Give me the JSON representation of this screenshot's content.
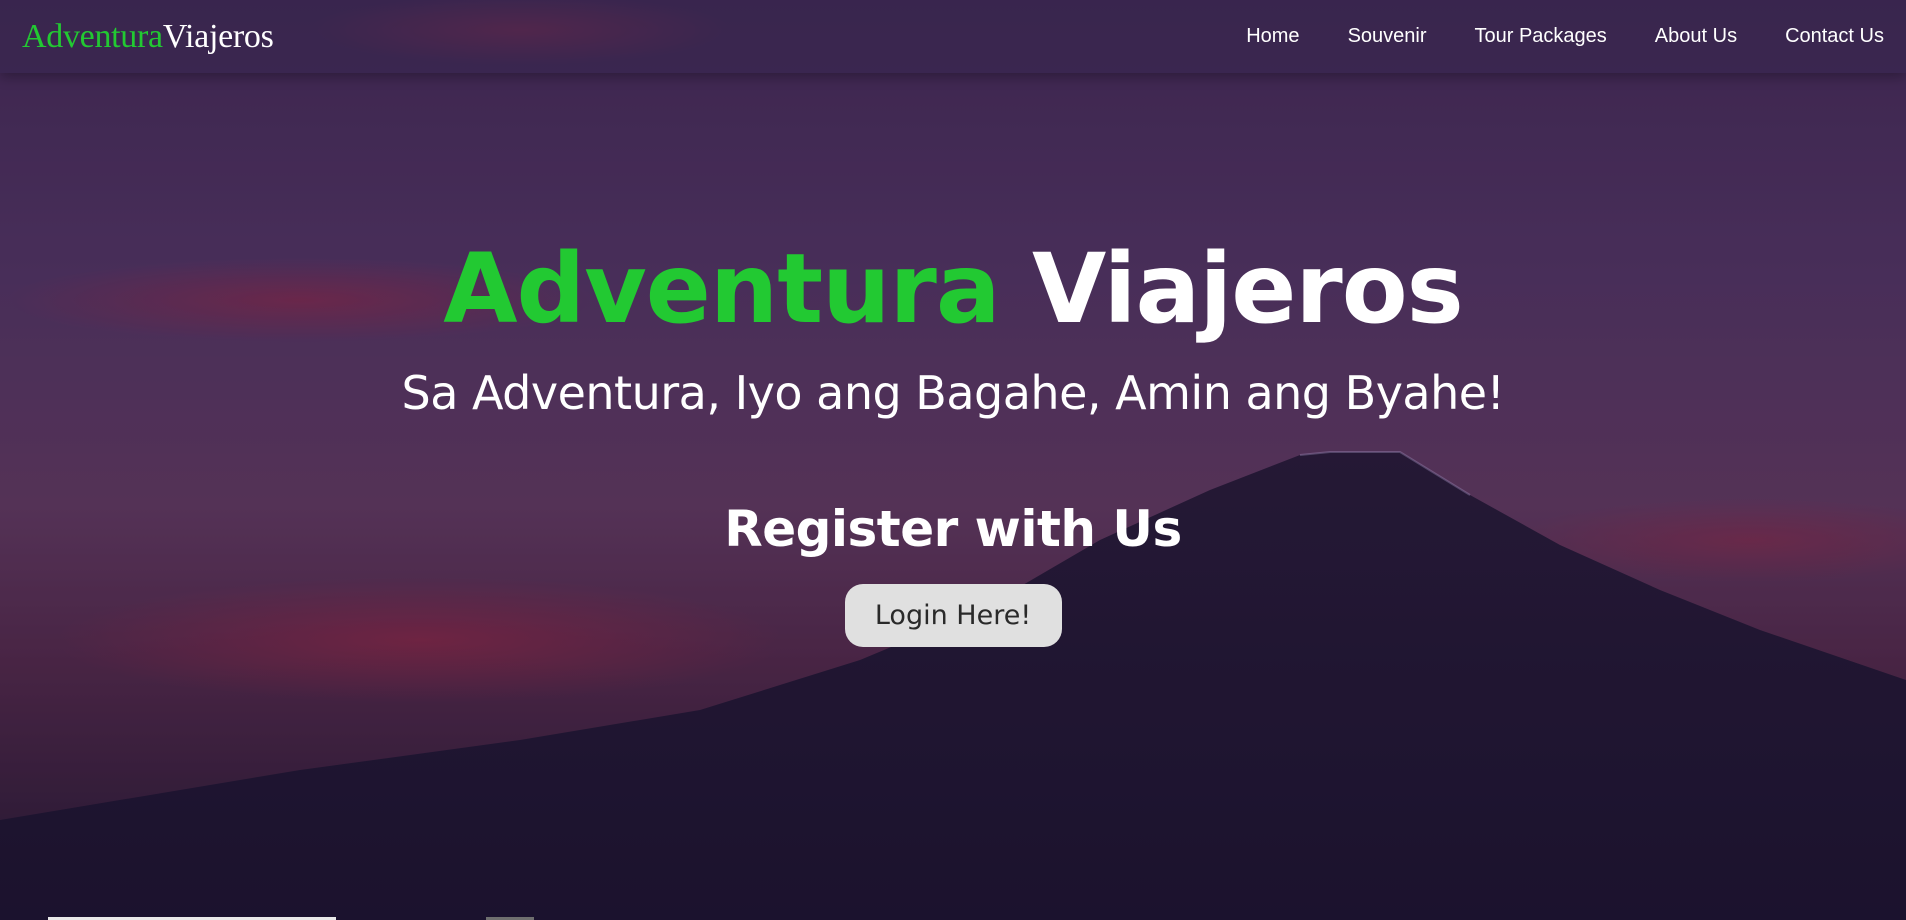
{
  "brand": {
    "part1": "Adventura",
    "part2": "Viajeros",
    "accent_color": "#22c932",
    "text_color": "#ffffff"
  },
  "nav": {
    "items": [
      {
        "label": "Home"
      },
      {
        "label": "Souvenir"
      },
      {
        "label": "Tour Packages"
      },
      {
        "label": "About Us"
      },
      {
        "label": "Contact Us"
      }
    ]
  },
  "hero": {
    "title_part1": "Adventura",
    "title_part2": "Viajeros",
    "tagline": "Sa Adventura, Iyo ang Bagahe, Amin ang Byahe!",
    "register_heading": "Register with Us",
    "login_button": "Login Here!"
  },
  "colors": {
    "button_bg": "#e0e0e0",
    "button_text": "#2a2a2a"
  }
}
